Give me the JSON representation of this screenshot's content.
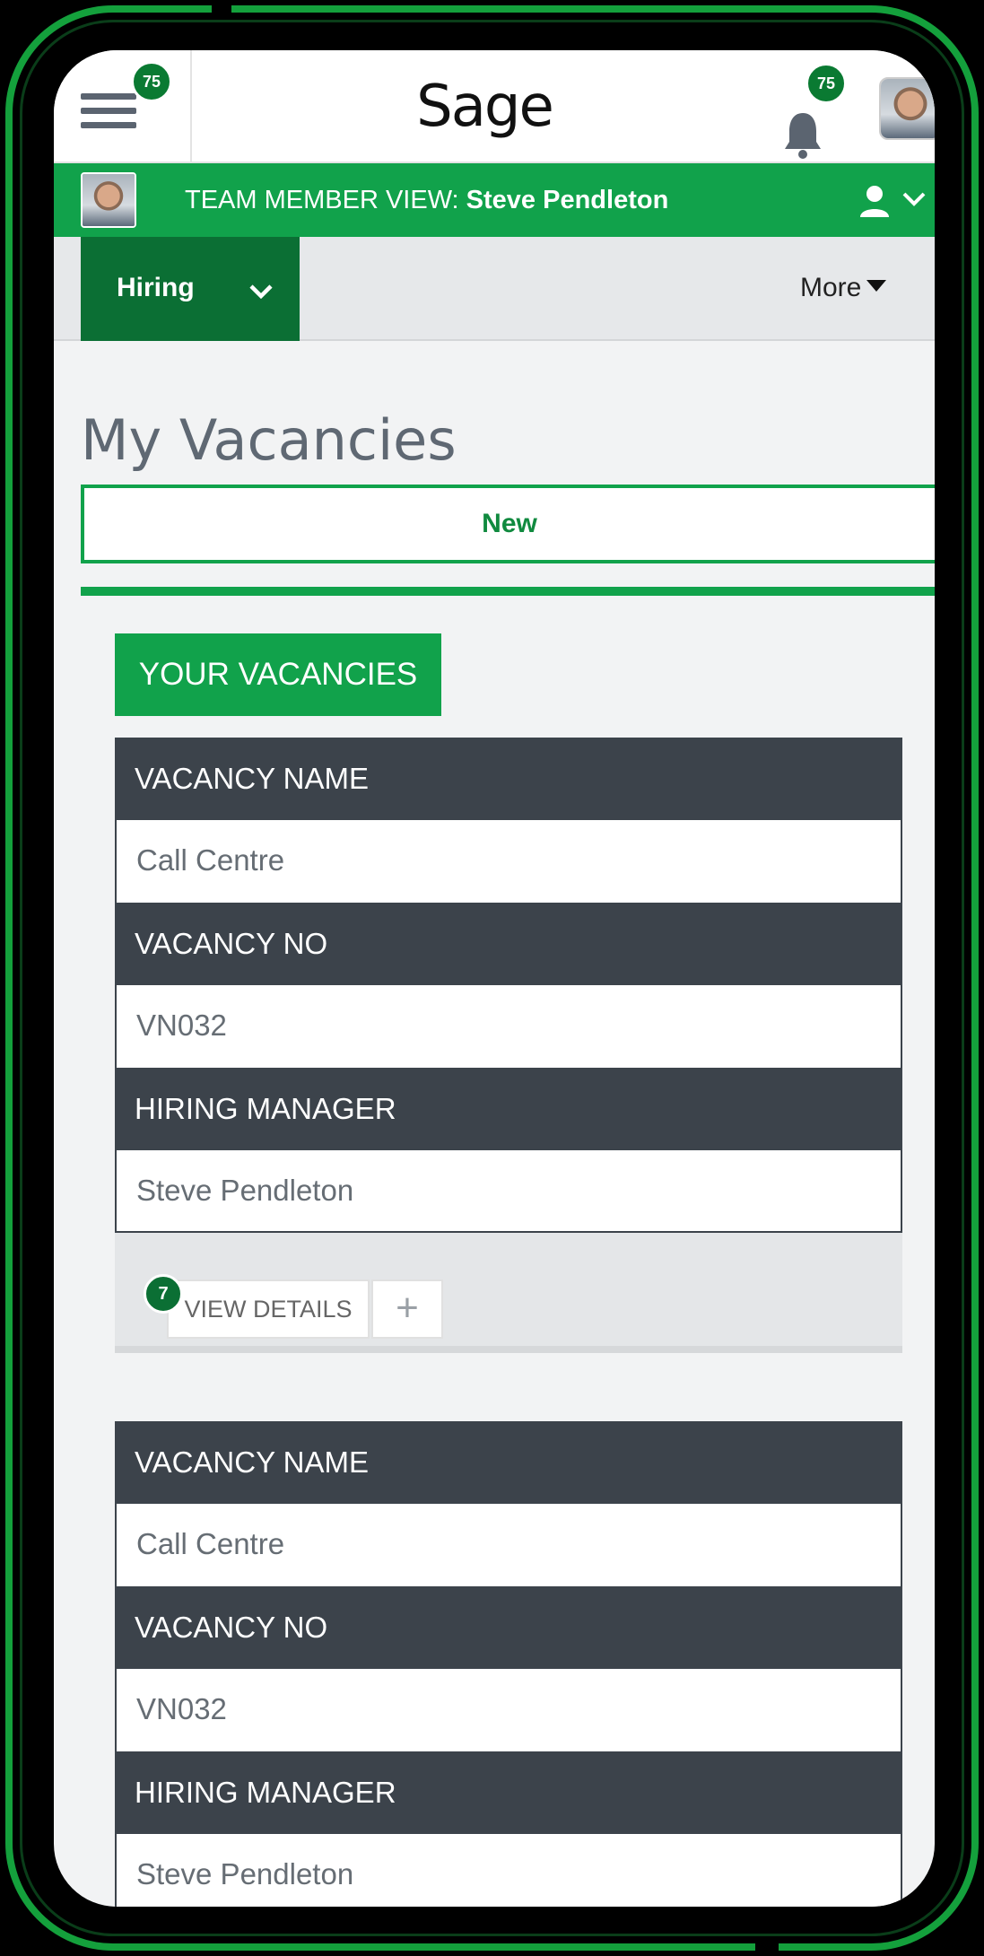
{
  "app": {
    "logo_text": "Sage",
    "menu_badge": "75",
    "notification_badge": "75"
  },
  "team_bar": {
    "prefix": "TEAM MEMBER VIEW: ",
    "name": "Steve Pendleton"
  },
  "nav": {
    "active_tab": "Hiring",
    "more_label": "More"
  },
  "page": {
    "title": "My Vacancies",
    "new_button": "New",
    "section_title": "YOUR VACANCIES"
  },
  "vacancies": [
    {
      "name_label": "VACANCY NAME",
      "name_value": "Call Centre",
      "no_label": "VACANCY NO",
      "no_value": "VN032",
      "manager_label": "HIRING MANAGER",
      "manager_value": "Steve Pendleton",
      "view_details_label": "VIEW DETAILS",
      "view_details_badge": "7",
      "add_label": "+"
    },
    {
      "name_label": "VACANCY NAME",
      "name_value": "Call Centre",
      "no_label": "VACANCY NO",
      "no_value": "VN032",
      "manager_label": "HIRING MANAGER",
      "manager_value": "Steve Pendleton"
    }
  ],
  "colors": {
    "brand_green": "#11a24b",
    "dark_green": "#0b6f34",
    "header_dark": "#3c434b",
    "frame_green": "#14a03c"
  }
}
